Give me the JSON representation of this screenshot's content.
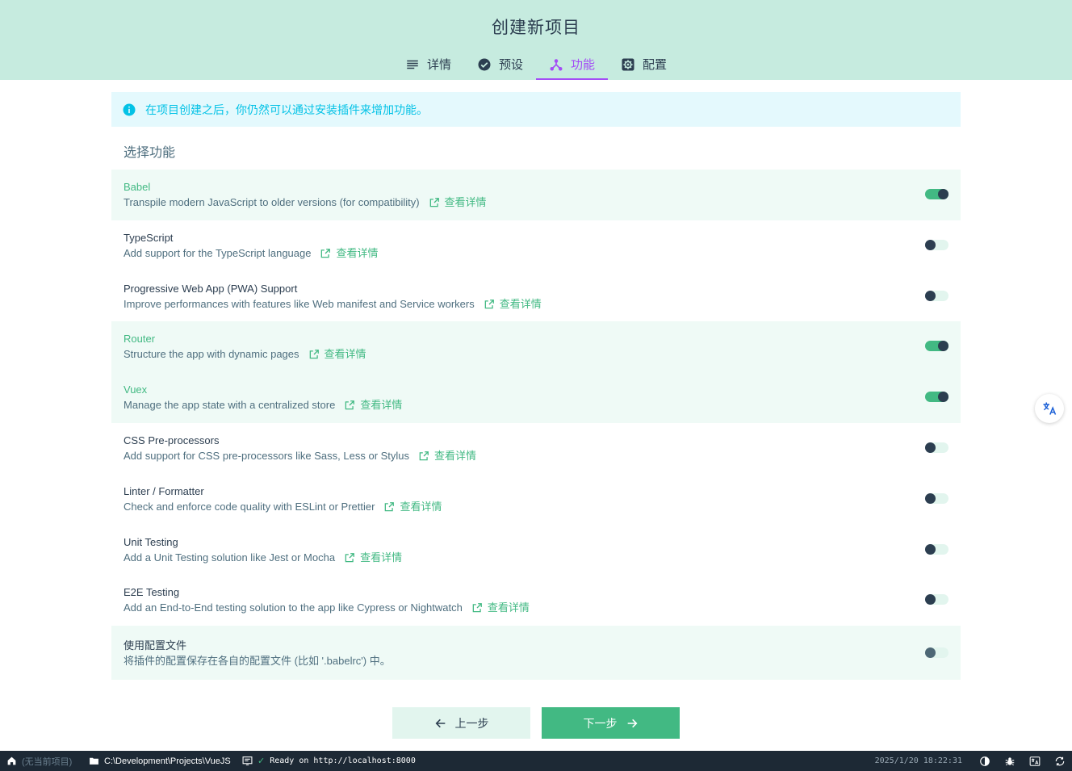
{
  "header": {
    "title": "创建新项目",
    "tabs": [
      {
        "label": "详情",
        "icon": "list-icon"
      },
      {
        "label": "预设",
        "icon": "check-circle-icon"
      },
      {
        "label": "功能",
        "icon": "call-split-icon",
        "active": true
      },
      {
        "label": "配置",
        "icon": "settings-box-icon"
      }
    ]
  },
  "info_banner": {
    "text": "在项目创建之后，你仍然可以通过安装插件来增加功能。"
  },
  "section_title": "选择功能",
  "more_label": "查看详情",
  "features": [
    {
      "name": "Babel",
      "description": "Transpile modern JavaScript to older versions (for compatibility)",
      "enabled": true
    },
    {
      "name": "TypeScript",
      "description": "Add support for the TypeScript language",
      "enabled": false
    },
    {
      "name": "Progressive Web App (PWA) Support",
      "description": "Improve performances with features like Web manifest and Service workers",
      "enabled": false
    },
    {
      "name": "Router",
      "description": "Structure the app with dynamic pages",
      "enabled": true
    },
    {
      "name": "Vuex",
      "description": "Manage the app state with a centralized store",
      "enabled": true
    },
    {
      "name": "CSS Pre-processors",
      "description": "Add support for CSS pre-processors like Sass, Less or Stylus",
      "enabled": false
    },
    {
      "name": "Linter / Formatter",
      "description": "Check and enforce code quality with ESLint or Prettier",
      "enabled": false
    },
    {
      "name": "Unit Testing",
      "description": "Add a Unit Testing solution like Jest or Mocha",
      "enabled": false
    },
    {
      "name": "E2E Testing",
      "description": "Add an End-to-End testing solution to the app like Cypress or Nightwatch",
      "enabled": false
    }
  ],
  "config_files": {
    "name": "使用配置文件",
    "description": "将插件的配置保存在各自的配置文件 (比如 '.babelrc') 中。",
    "enabled": false
  },
  "buttons": {
    "prev": "上一步",
    "next": "下一步"
  },
  "statusbar": {
    "project": "(无当前项目)",
    "path": "C:\\Development\\Projects\\VueJS",
    "log": "Ready on http://localhost:8000",
    "datetime": "2025/1/20 18:22:31"
  },
  "colors": {
    "accent": "#42b983",
    "header_bg": "#c6ebdf",
    "tab_active": "#a44cf6",
    "info": "#03c2e6",
    "statusbar": "#1d2935"
  }
}
